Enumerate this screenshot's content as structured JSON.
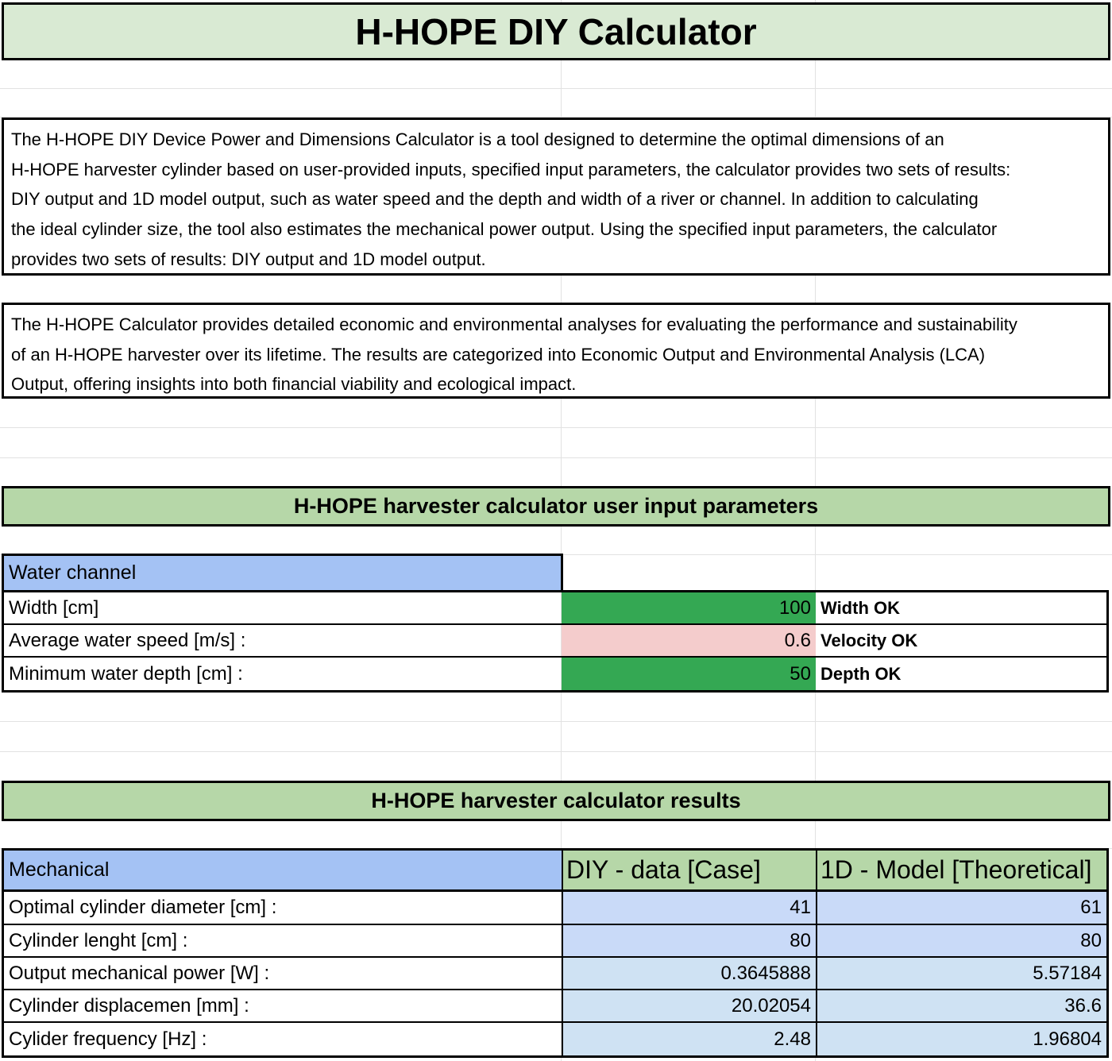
{
  "title": "H-HOPE DIY Calculator",
  "description_1": "The H-HOPE DIY Device Power and Dimensions Calculator is a tool designed to determine the optimal dimensions of an\nH-HOPE harvester cylinder based on user-provided inputs, specified input parameters, the calculator provides two sets of results:\nDIY output and 1D model output, such as water speed and the depth and width of a river or channel. In addition to calculating\nthe ideal cylinder size, the tool also estimates the mechanical power output. Using the specified input parameters, the calculator\nprovides two sets of results: DIY output and 1D model output.",
  "description_2": "The H-HOPE Calculator provides detailed economic and environmental analyses for evaluating the performance and sustainability\nof an H-HOPE harvester over its lifetime. The results are categorized into Economic Output and Environmental Analysis (LCA)\nOutput, offering insights into both financial viability and ecological impact.",
  "inputs_section_title": "H-HOPE harvester calculator user input parameters",
  "inputs": {
    "header": "Water channel",
    "rows": [
      {
        "label": "Width [cm]",
        "value": "100",
        "status": "Width OK"
      },
      {
        "label": "Average water speed [m/s] :",
        "value": "0.6",
        "status": "Velocity OK"
      },
      {
        "label": "Minimum water depth [cm] :",
        "value": "50",
        "status": "Depth OK"
      }
    ]
  },
  "results_section_title": "H-HOPE harvester calculator results",
  "results": {
    "header": "Mechanical",
    "col1": "DIY - data [Case]",
    "col2": "1D - Model [Theoretical]",
    "rows": [
      {
        "label": "Optimal cylinder diameter [cm] :",
        "diy": "41",
        "model": "61"
      },
      {
        "label": "Cylinder lenght [cm] :",
        "diy": "80",
        "model": "80"
      },
      {
        "label": "Output mechanical power [W] :",
        "diy": "0.3645888",
        "model": "5.57184"
      },
      {
        "label": "Cylinder displacemen [mm] :",
        "diy": "20.02054",
        "model": "36.6"
      },
      {
        "label": "Cylider frequency [Hz] :",
        "diy": "2.48",
        "model": "1.96804"
      }
    ]
  },
  "colors": {
    "title_bg": "#d9ead3",
    "banner_bg": "#b6d7a8",
    "header_blue": "#a4c2f4",
    "input_green": "#34a853",
    "input_pink": "#f4cccc",
    "result_blue": "#c9daf8"
  }
}
